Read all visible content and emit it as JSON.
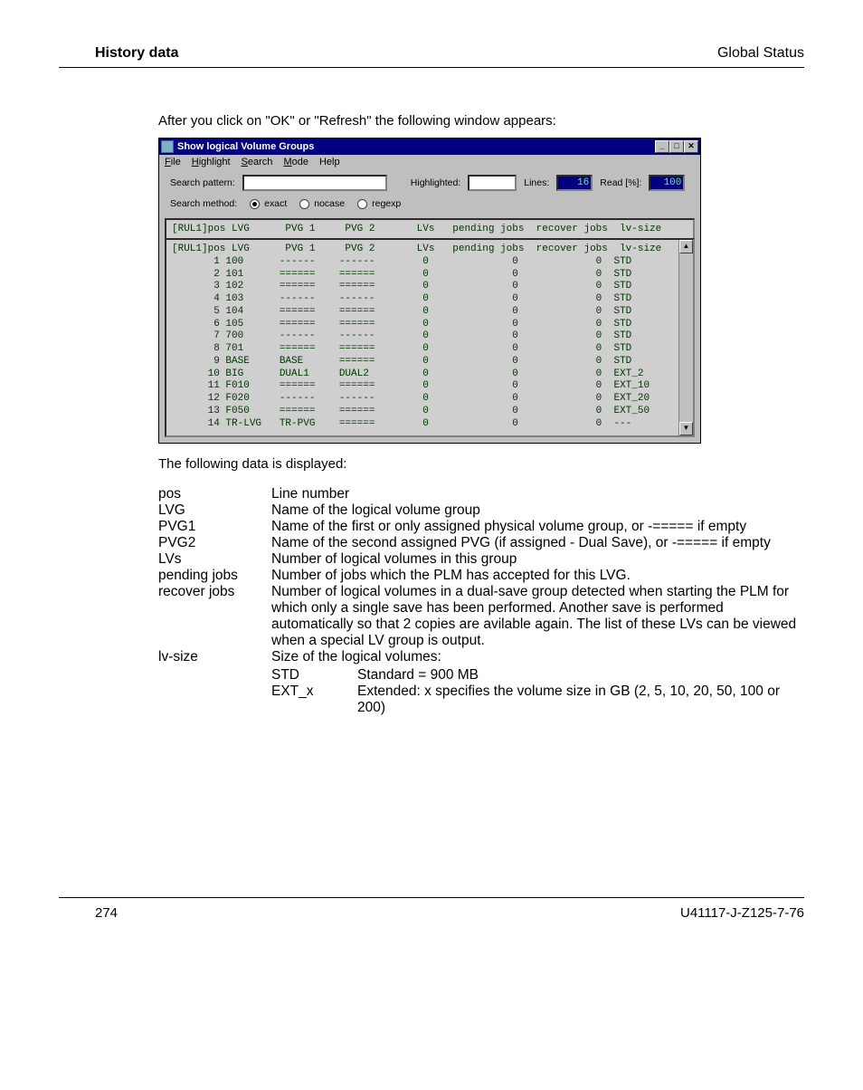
{
  "header": {
    "left": "History data",
    "right": "Global Status"
  },
  "intro": "After you click on \"OK\" or \"Refresh\" the following window appears:",
  "window": {
    "title": "Show logical Volume Groups",
    "menu": [
      "File",
      "Highlight",
      "Search",
      "Mode",
      "Help"
    ],
    "labels": {
      "search_pattern": "Search pattern:",
      "highlighted": "Highlighted:",
      "lines": "Lines:",
      "read": "Read [%]:",
      "search_method": "Search method:"
    },
    "lines_value": "16",
    "read_value": "100",
    "methods": [
      {
        "label": "exact",
        "selected": true
      },
      {
        "label": "nocase",
        "selected": false
      },
      {
        "label": "regexp",
        "selected": false
      }
    ],
    "term_header": "[RUL1]pos LVG      PVG 1     PVG 2       LVs   pending jobs  recover jobs  lv-size",
    "term_lines": [
      "[RUL1]pos LVG      PVG 1     PVG 2       LVs   pending jobs  recover jobs  lv-size",
      "       1 100      ------    ------        0              0             0  STD",
      "       2 101      ======    ======        0              0             0  STD",
      "       3 102      ======    ======        0              0             0  STD",
      "       4 103      ------    ------        0              0             0  STD",
      "       5 104      ======    ======        0              0             0  STD",
      "       6 105      ======    ======        0              0             0  STD",
      "       7 700      ------    ------        0              0             0  STD",
      "       8 701      ======    ======        0              0             0  STD",
      "       9 BASE     BASE      ======        0              0             0  STD",
      "      10 BIG      DUAL1     DUAL2         0              0             0  EXT_2",
      "      11 F010     ======    ======        0              0             0  EXT_10",
      "      12 F020     ------    ------        0              0             0  EXT_20",
      "      13 F050     ======    ======        0              0             0  EXT_50",
      "      14 TR-LVG   TR-PVG    ======        0              0             0  ---"
    ]
  },
  "after": "The following data is displayed:",
  "defs": [
    {
      "term": "pos",
      "desc": "Line number"
    },
    {
      "term": "LVG",
      "desc": "Name of the logical volume group"
    },
    {
      "term": "PVG1",
      "desc": "Name of the first or only assigned physical volume group, or -===== if empty"
    },
    {
      "term": "PVG2",
      "desc": "Name of the second assigned PVG (if assigned - Dual Save), or -===== if empty"
    },
    {
      "term": "LVs",
      "desc": "Number of logical volumes in this group"
    },
    {
      "term": "pending jobs",
      "desc": "Number of jobs which the PLM has accepted for this LVG."
    },
    {
      "term": "recover jobs",
      "desc": "Number of logical volumes in a dual-save group detected when starting the PLM for which only a single save has been performed. Another save is performed automatically so that 2 copies are avilable again. The list of these LVs can be viewed when a special LV group is output."
    },
    {
      "term": "lv-size",
      "desc": "Size of the logical volumes:",
      "sub": [
        {
          "k": "STD",
          "v": "Standard = 900 MB"
        },
        {
          "k": "EXT_x",
          "v": "Extended: x specifies the volume size in GB (2, 5, 10, 20, 50, 100 or 200)"
        }
      ]
    }
  ],
  "footer": {
    "left": "274",
    "right": "U41117-J-Z125-7-76"
  }
}
